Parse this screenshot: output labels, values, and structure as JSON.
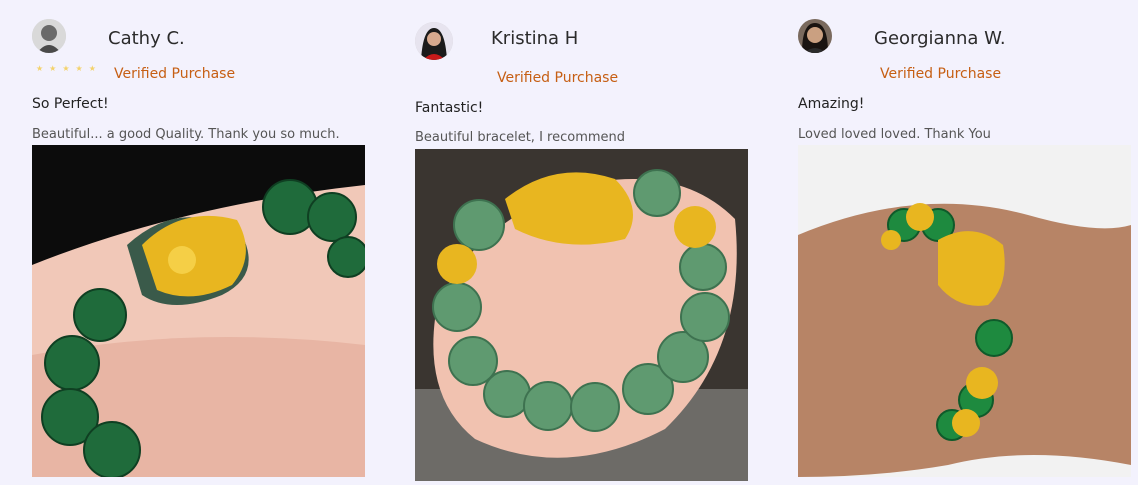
{
  "reviews": [
    {
      "name": "Cathy C.",
      "verified": "Verified Purchase",
      "title": "So Perfect!",
      "body": "Beautiful... a good Quality. Thank you so much.",
      "stars": "★★★★★",
      "photo_icon": "bracelet-photo"
    },
    {
      "name": "Kristina H",
      "verified": "Verified Purchase",
      "title": "Fantastic!",
      "body": "Beautiful bracelet, I recommend",
      "photo_icon": "bracelet-photo"
    },
    {
      "name": "Georgianna W.",
      "verified": "Verified Purchase",
      "title": "Amazing!",
      "body": "Loved loved loved. Thank You",
      "photo_icon": "bracelet-photo"
    }
  ],
  "colors": {
    "background": "#f3f2fd",
    "verified": "#c65f14",
    "star": "#f3d26b",
    "jade_dark": "#1f6b3b",
    "jade_light": "#5f9a70",
    "gold": "#e8b620"
  }
}
